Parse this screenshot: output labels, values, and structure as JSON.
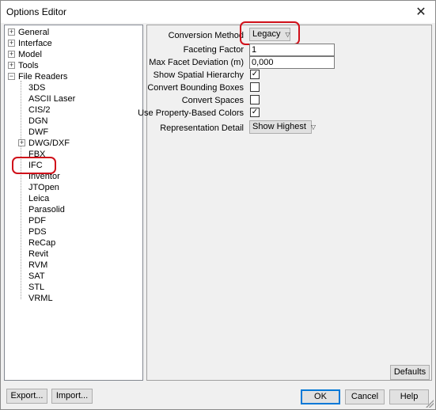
{
  "window": {
    "title": "Options Editor",
    "close_glyph": "✕"
  },
  "tree": {
    "expanded_parents": [
      {
        "label": "General",
        "expander": "+"
      },
      {
        "label": "Interface",
        "expander": "+"
      },
      {
        "label": "Model",
        "expander": "+"
      },
      {
        "label": "Tools",
        "expander": "+"
      },
      {
        "label": "File Readers",
        "expander": "−"
      }
    ],
    "file_readers": [
      "3DS",
      "ASCII Laser",
      "CIS/2",
      "DGN",
      "DWF",
      "DWG/DXF",
      "FBX",
      "IFC",
      "Inventor",
      "JTOpen",
      "Leica",
      "Parasolid",
      "PDF",
      "PDS",
      "ReCap",
      "Revit",
      "RVM",
      "SAT",
      "STL",
      "VRML"
    ],
    "dwg_expander": "+",
    "selected": "IFC"
  },
  "options": {
    "conversion_method": {
      "label": "Conversion Method",
      "value": "Legacy"
    },
    "faceting_factor": {
      "label": "Faceting Factor",
      "value": "1"
    },
    "max_facet_deviation": {
      "label": "Max Facet Deviation (m)",
      "value": "0,000"
    },
    "show_spatial_hierarchy": {
      "label": "Show Spatial Hierarchy",
      "checked": true
    },
    "convert_bounding_boxes": {
      "label": "Convert Bounding Boxes",
      "checked": false
    },
    "convert_spaces": {
      "label": "Convert Spaces",
      "checked": false
    },
    "use_property_colors": {
      "label": "Use Property-Based Colors",
      "checked": true
    },
    "representation_detail": {
      "label": "Representation Detail",
      "value": "Show Highest"
    }
  },
  "buttons": {
    "defaults": "Defaults",
    "export": "Export...",
    "import": "Import...",
    "ok": "OK",
    "cancel": "Cancel",
    "help": "Help"
  },
  "glyphs": {
    "check": "✓",
    "dropdown": "▽"
  },
  "colors": {
    "highlight": "#d0101a",
    "default_button": "#0078d7"
  }
}
